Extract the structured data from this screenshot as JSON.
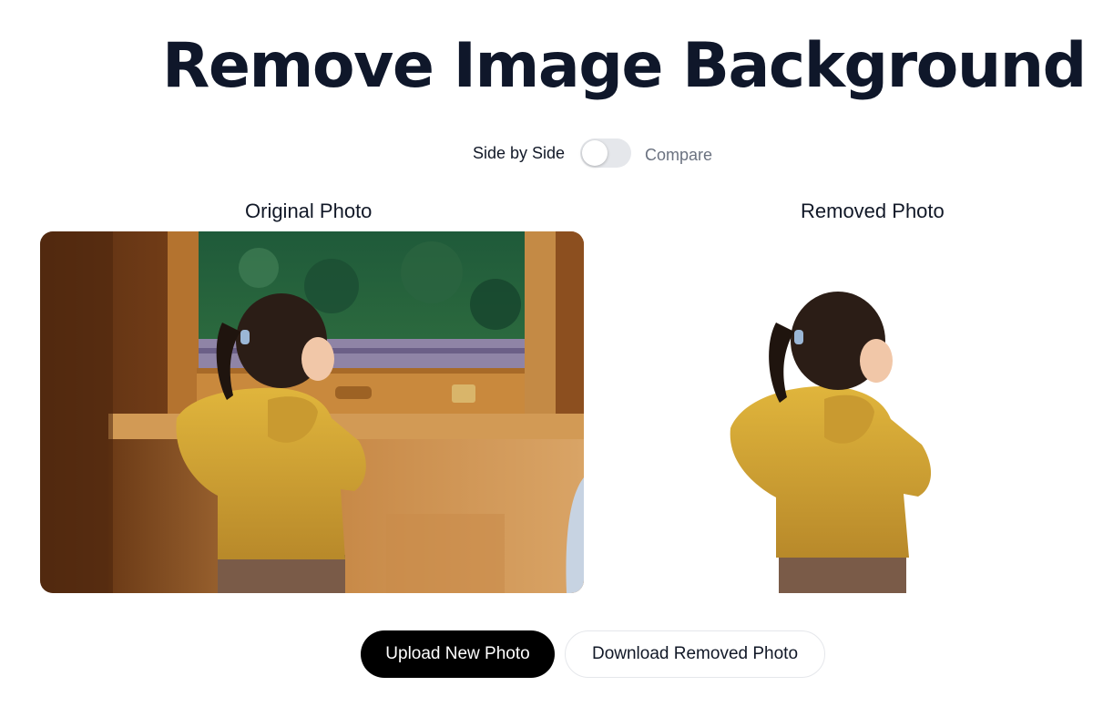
{
  "page": {
    "title": "Remove Image Background"
  },
  "view_toggle": {
    "left_label": "Side by Side",
    "right_label": "Compare",
    "compare_enabled": false
  },
  "columns": {
    "original_heading": "Original Photo",
    "removed_heading": "Removed Photo"
  },
  "actions": {
    "upload_label": "Upload New Photo",
    "download_label": "Download Removed Photo"
  },
  "colors": {
    "title": "#0f172a",
    "primary_button_bg": "#000000",
    "toggle_track": "#e5e7eb",
    "muted_text": "#6b7280"
  }
}
